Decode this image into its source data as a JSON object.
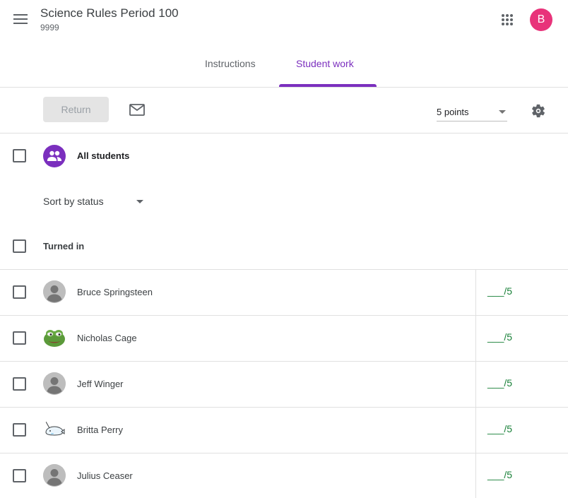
{
  "header": {
    "class_title": "Science Rules Period 100",
    "class_subtitle": "9999",
    "account_initial": "B",
    "account_color": "#e8337a"
  },
  "tabs": [
    {
      "label": "Instructions",
      "active": false
    },
    {
      "label": "Student work",
      "active": true
    }
  ],
  "toolbar": {
    "return_label": "Return",
    "points_label": "5 points"
  },
  "all_students": {
    "label": "All students"
  },
  "sort": {
    "label": "Sort by status"
  },
  "section": {
    "label": "Turned in"
  },
  "students": [
    {
      "name": "Bruce Springsteen",
      "grade": "___/5",
      "avatar": "default-avatar-icon"
    },
    {
      "name": "Nicholas Cage",
      "grade": "___/5",
      "avatar": "frog-avatar-icon"
    },
    {
      "name": "Jeff Winger",
      "grade": "___/5",
      "avatar": "default-avatar-icon"
    },
    {
      "name": "Britta Perry",
      "grade": "___/5",
      "avatar": "narwhal-avatar-icon"
    },
    {
      "name": "Julius Ceaser",
      "grade": "___/5",
      "avatar": "default-avatar-icon"
    }
  ],
  "colors": {
    "accent": "#7b2fbe",
    "grade": "#188038"
  }
}
